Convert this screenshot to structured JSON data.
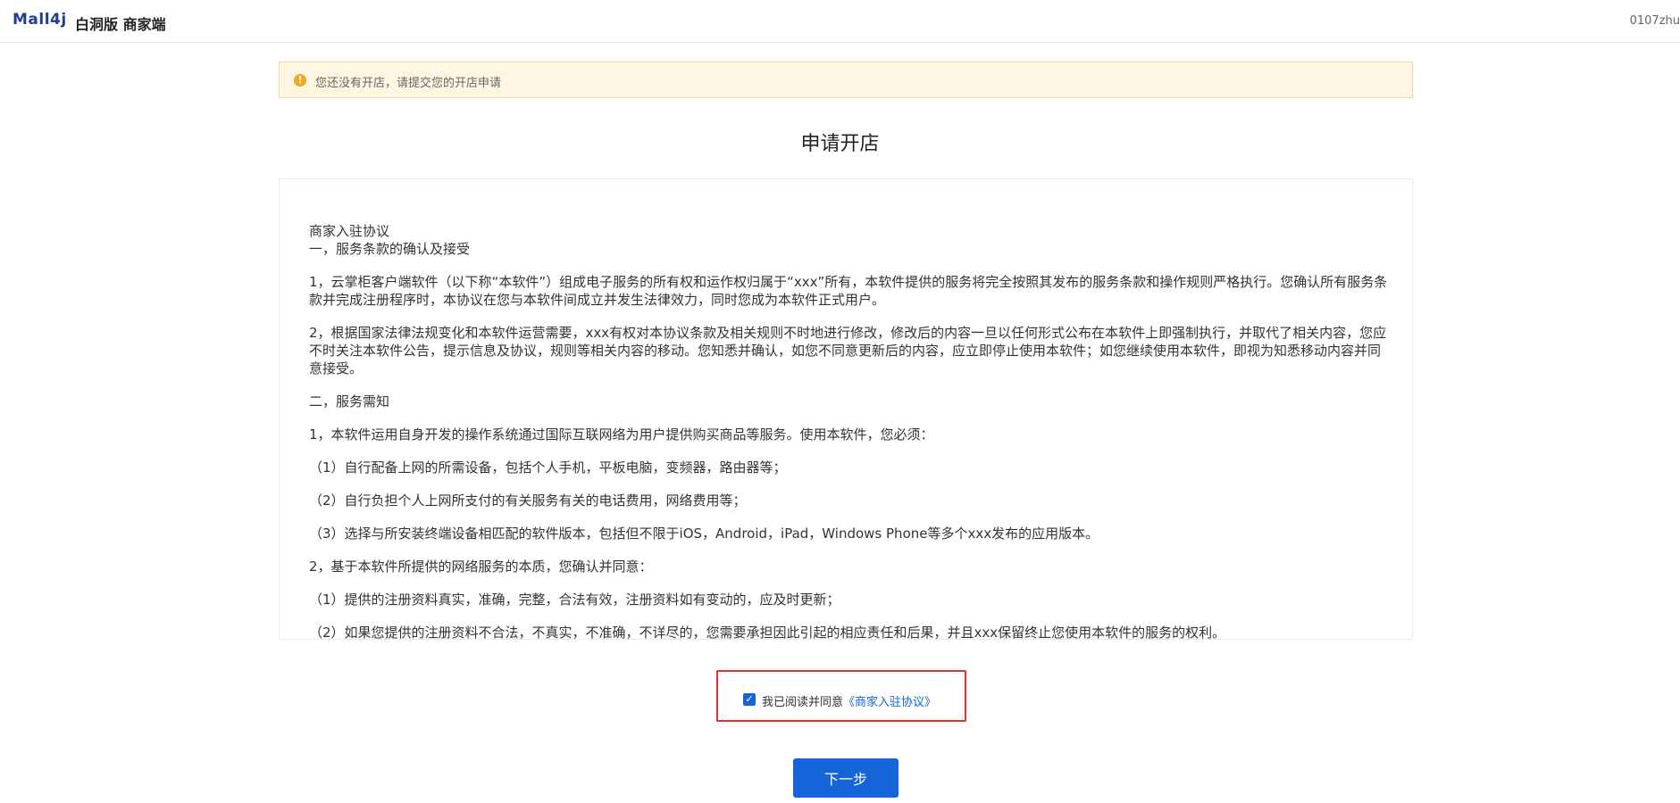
{
  "header": {
    "logo": "Mall4j",
    "edition": "白洞版 商家端",
    "username": "0107zhu"
  },
  "notice": {
    "icon": "warning-icon",
    "text": "您还没有开店，请提交您的开店申请"
  },
  "page_title": "申请开店",
  "agreement": {
    "lines": [
      "商家入驻协议",
      "一，服务条款的确认及接受",
      "1，云掌柜客户端软件（以下称“本软件”）组成电子服务的所有权和运作权归属于“xxx”所有，本软件提供的服务将完全按照其发布的服务条款和操作规则严格执行。您确认所有服务条款并完成注册程序时，本协议在您与本软件间成立并发生法律效力，同时您成为本软件正式用户。",
      "2，根据国家法律法规变化和本软件运营需要，xxx有权对本协议条款及相关规则不时地进行修改，修改后的内容一旦以任何形式公布在本软件上即强制执行，并取代了相关内容，您应不时关注本软件公告，提示信息及协议，规则等相关内容的移动。您知悉并确认，如您不同意更新后的内容，应立即停止使用本软件；如您继续使用本软件，即视为知悉移动内容并同意接受。",
      "二，服务需知",
      "1，本软件运用自身开发的操作系统通过国际互联网络为用户提供购买商品等服务。使用本软件，您必须：",
      "（1）自行配备上网的所需设备，包括个人手机，平板电脑，变频器，路由器等；",
      "（2）自行负担个人上网所支付的有关服务有关的电话费用，网络费用等；",
      "（3）选择与所安装终端设备相匹配的软件版本，包括但不限于iOS，Android，iPad，Windows Phone等多个xxx发布的应用版本。",
      "2，基于本软件所提供的网络服务的本质，您确认并同意：",
      "（1）提供的注册资料真实，准确，完整，合法有效，注册资料如有变动的，应及时更新；",
      "（2）如果您提供的注册资料不合法，不真实，不准确，不详尽的，您需要承担因此引起的相应责任和后果，并且xxx保留终止您使用本软件的服务的权利。"
    ]
  },
  "consent": {
    "checked": true,
    "label": "我已阅读并同意",
    "link": "《商家入驻协议》"
  },
  "next_button": "下一步"
}
